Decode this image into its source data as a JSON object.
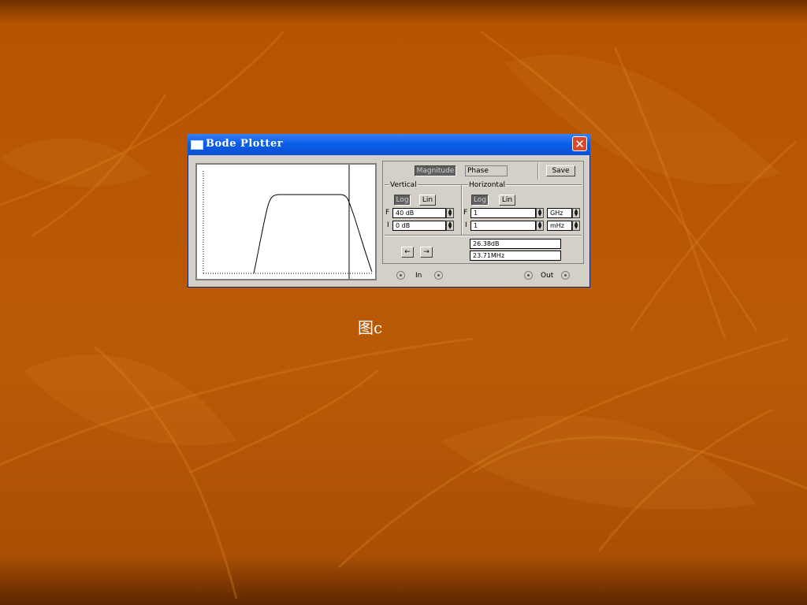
{
  "window": {
    "title": "Bode Plotter",
    "close_glyph": "✕"
  },
  "mode": {
    "magnitude": "Magnitude",
    "phase": "Phase",
    "save": "Save"
  },
  "vertical": {
    "label": "Vertical",
    "log": "Log",
    "lin": "Lin",
    "f_label": "F",
    "f_value": "40 dB",
    "i_label": "I",
    "i_value": "0 dB"
  },
  "horizontal": {
    "label": "Horizontal",
    "log": "Log",
    "lin": "Lin",
    "f_label": "F",
    "f_value": "1",
    "f_unit": "GHz",
    "i_label": "I",
    "i_value": "1",
    "i_unit": "mHz"
  },
  "cursor": {
    "left_arrow": "←",
    "right_arrow": "→",
    "magnitude_readout": "26.38dB",
    "frequency_readout": "23.71MHz"
  },
  "terminals": {
    "in_label": "In",
    "out_label": "Out"
  },
  "slide": {
    "caption": "图c"
  },
  "colors": {
    "title_bar": "#0b5fe8",
    "window_bg": "#d4d0c8",
    "slide_bg": "#b65300",
    "close_button": "#d94a2a"
  }
}
